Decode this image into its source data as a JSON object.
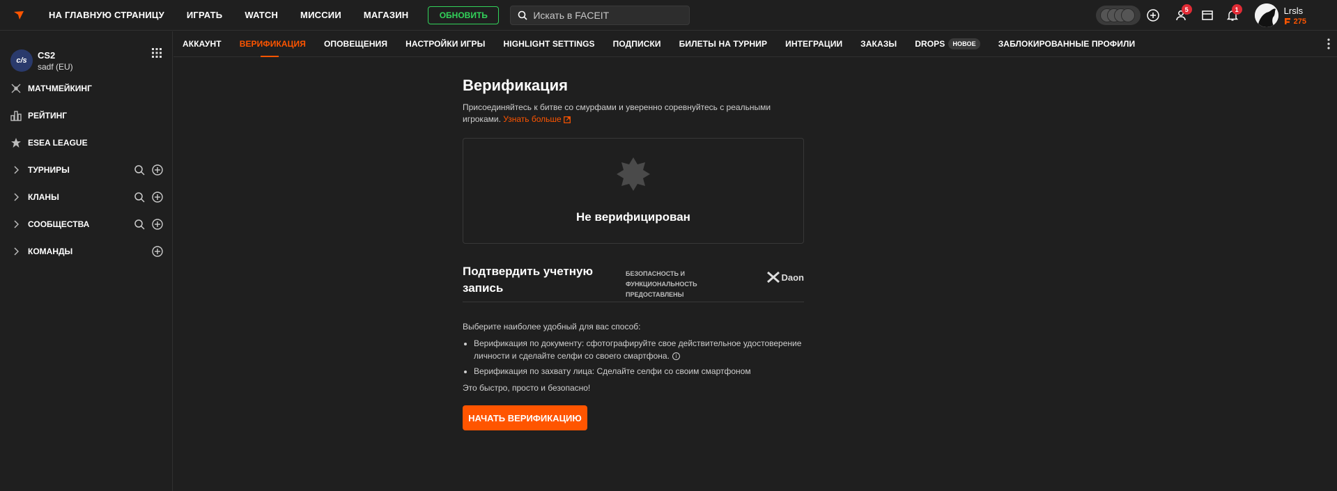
{
  "topbar": {
    "nav": [
      "НА ГЛАВНУЮ СТРАНИЦУ",
      "ИГРАТЬ",
      "WATCH",
      "МИССИИ",
      "МАГАЗИН"
    ],
    "upgrade_label": "ОБНОВИТЬ",
    "search_placeholder": "Искать в FACEIT",
    "friends_badge": "5",
    "notifications_badge": "1",
    "username": "Lrsls",
    "points": "275"
  },
  "sidebar": {
    "game_title": "CS2",
    "game_logo_text": "c/s",
    "game_sub": "sadf (EU)",
    "items": [
      {
        "label": "МАТЧМЕЙКИНГ",
        "icon": "matchmaking-icon"
      },
      {
        "label": "РЕЙТИНГ",
        "icon": "ranking-icon"
      },
      {
        "label": "ESEA LEAGUE",
        "icon": "esea-icon"
      },
      {
        "label": "ТУРНИРЫ",
        "icon": "chevron-right-icon"
      },
      {
        "label": "КЛАНЫ",
        "icon": "chevron-right-icon"
      },
      {
        "label": "СООБЩЕСТВА",
        "icon": "chevron-right-icon"
      },
      {
        "label": "КОМАНДЫ",
        "icon": "chevron-right-icon"
      }
    ]
  },
  "tabs": [
    "АККАУНТ",
    "ВЕРИФИКАЦИЯ",
    "ОПОВЕЩЕНИЯ",
    "НАСТРОЙКИ ИГРЫ",
    "HIGHLIGHT SETTINGS",
    "ПОДПИСКИ",
    "БИЛЕТЫ НА ТУРНИР",
    "ИНТЕГРАЦИИ",
    "ЗАКАЗЫ",
    "DROPS",
    "ЗАБЛОКИРОВАННЫЕ ПРОФИЛИ"
  ],
  "new_badge": "НОВОЕ",
  "page": {
    "title": "Верификация",
    "intro": "Присоединяйтесь к битве со смурфами и уверенно соревнуйтесь с реальными игроками.",
    "learn_more": "Узнать больше",
    "status": "Не верифицирован",
    "verify_title": "Подтвердить учетную запись",
    "provided_by": "БЕЗОПАСНОСТЬ И ФУНКЦИОНАЛЬНОСТЬ ПРЕДОСТАВЛЕНЫ",
    "provider": "Daon",
    "choose": "Выберите наиболее удобный для вас способ:",
    "methods": [
      "Верификация по документу: сфотографируйте свое действительное удостоверение личности и сделайте селфи со своего смартфона.",
      "Верификация по захвату лица: Сделайте селфи со своим смартфоном"
    ],
    "safe": "Это быстро, просто и безопасно!",
    "start_button": "Начать верификацию"
  },
  "colors": {
    "accent": "#ff5500",
    "upgrade": "#32d35a",
    "badge": "#e12b35",
    "bg": "#1f1f1f"
  }
}
